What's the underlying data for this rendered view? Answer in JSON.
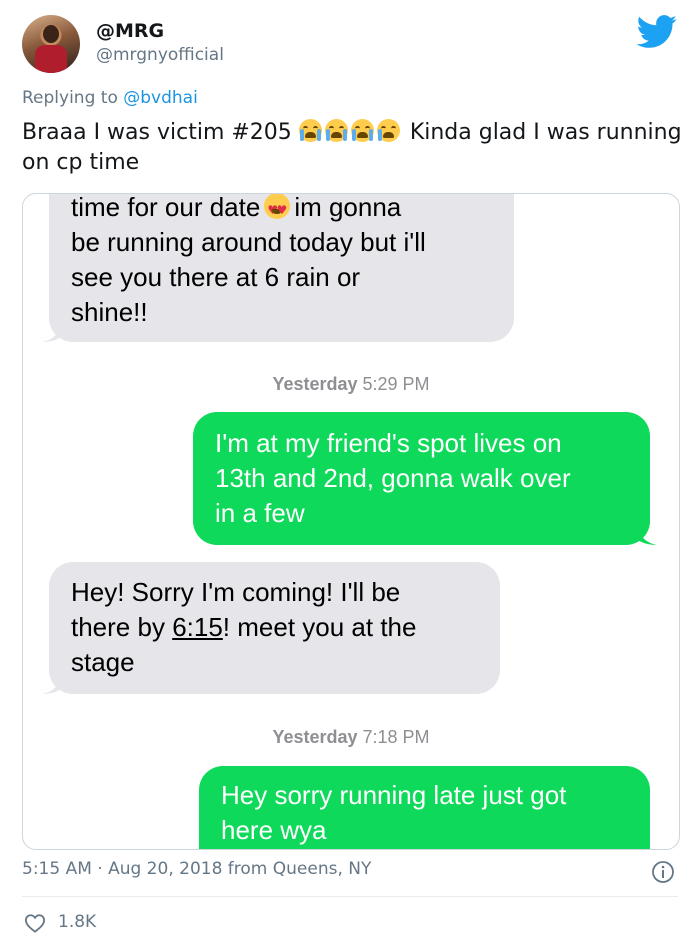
{
  "header": {
    "display_name": "@MRG",
    "username": "@mrgnyofficial"
  },
  "reply": {
    "prefix": "Replying to",
    "handle": "@bvdhai"
  },
  "tweet": {
    "text_part1": "Braaa I was victim #205",
    "emojis": [
      "loudly-crying-face",
      "loudly-crying-face",
      "loudly-crying-face",
      "face-with-tears-of-joy"
    ],
    "text_part2": "Kinda glad I was running on cp time"
  },
  "conversation": {
    "msg1": {
      "line1a": "time for our date",
      "line1_emoji": "smiling-face-with-heart-eyes",
      "line1b": "im gonna",
      "line2": "be running around today but i'll",
      "line3": "see you there at 6 rain or",
      "line4": "shine!!"
    },
    "ts1": {
      "day": "Yesterday",
      "time": "5:29 PM"
    },
    "msg2": {
      "line1": "I'm at my friend's spot lives on",
      "line2": "13th and 2nd, gonna walk over",
      "line3": "in a few"
    },
    "msg3": {
      "line1": "Hey! Sorry I'm coming! I'll be",
      "line2a": "there by",
      "line2_link": "6:15",
      "line2b": "! meet you at the",
      "line3": "stage"
    },
    "ts2": {
      "day": "Yesterday",
      "time": "7:18 PM"
    },
    "msg4": {
      "line1": "Hey sorry running late just got",
      "line2": "here wya"
    },
    "colors": {
      "received": "#e5e5ea",
      "sent": "#0fd95a"
    }
  },
  "footer": {
    "meta": "5:15 AM · Aug 20, 2018 from Queens, NY",
    "likes": "1.8K"
  },
  "colors": {
    "twitter_blue": "#1da1f2",
    "link": "#1b95e0",
    "secondary": "#657786"
  }
}
